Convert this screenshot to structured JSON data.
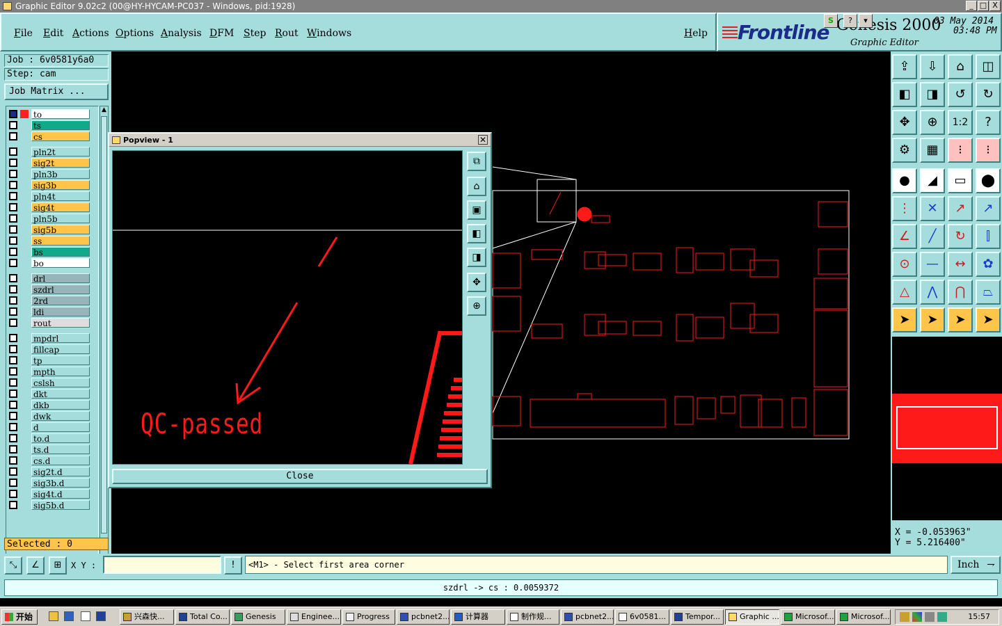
{
  "window": {
    "title": "Graphic Editor 9.02c2 (00@HY-HYCAM-PC037 - Windows, pid:1928)",
    "controls": [
      "_",
      "□",
      "X"
    ]
  },
  "menu": {
    "items": [
      "File",
      "Edit",
      "Actions",
      "Options",
      "Analysis",
      "DFM",
      "Step",
      "Rout",
      "Windows"
    ],
    "help": "Help"
  },
  "brand": {
    "logo": "Frontline",
    "product": "Genesis 2000",
    "subtitle": "Graphic Editor",
    "date": "03 May 2014",
    "time": "03:48 PM"
  },
  "job": {
    "job_label": "Job : 6v0581y6a0",
    "step_label": "Step: cam",
    "matrix_button": "Job Matrix ..."
  },
  "layers": [
    {
      "name": "to",
      "color": "#ffffff",
      "active": true
    },
    {
      "name": "ts",
      "color": "#12a98a"
    },
    {
      "name": "cs",
      "color": "#ffc54a"
    },
    {
      "name": "pln2t",
      "color": "#a5dcdc"
    },
    {
      "name": "sig2t",
      "color": "#ffc54a"
    },
    {
      "name": "pln3b",
      "color": "#a5dcdc"
    },
    {
      "name": "sig3b",
      "color": "#ffc54a"
    },
    {
      "name": "pln4t",
      "color": "#a5dcdc"
    },
    {
      "name": "sig4t",
      "color": "#ffc54a"
    },
    {
      "name": "pln5b",
      "color": "#a5dcdc"
    },
    {
      "name": "sig5b",
      "color": "#ffc54a"
    },
    {
      "name": "ss",
      "color": "#ffc54a"
    },
    {
      "name": "bs",
      "color": "#12a98a"
    },
    {
      "name": "bo",
      "color": "#ffffff"
    },
    {
      "name": "drl",
      "color": "#97b4b8"
    },
    {
      "name": "szdrl",
      "color": "#97b4b8"
    },
    {
      "name": "2rd",
      "color": "#97b4b8"
    },
    {
      "name": "ldi",
      "color": "#97b4b8"
    },
    {
      "name": "rout",
      "color": "#dddddd"
    },
    {
      "name": "mpdrl",
      "color": "#a5dcdc"
    },
    {
      "name": "fillcap",
      "color": "#a5dcdc"
    },
    {
      "name": "tp",
      "color": "#a5dcdc"
    },
    {
      "name": "mpth",
      "color": "#a5dcdc"
    },
    {
      "name": "cslsh",
      "color": "#a5dcdc"
    },
    {
      "name": "dkt",
      "color": "#a5dcdc"
    },
    {
      "name": "dkb",
      "color": "#a5dcdc"
    },
    {
      "name": "dwk",
      "color": "#a5dcdc"
    },
    {
      "name": "d",
      "color": "#a5dcdc"
    },
    {
      "name": "to.d",
      "color": "#a5dcdc"
    },
    {
      "name": "ts.d",
      "color": "#a5dcdc"
    },
    {
      "name": "cs.d",
      "color": "#a5dcdc"
    },
    {
      "name": "sig2t.d",
      "color": "#a5dcdc"
    },
    {
      "name": "sig3b.d",
      "color": "#a5dcdc"
    },
    {
      "name": "sig4t.d",
      "color": "#a5dcdc"
    },
    {
      "name": "sig5b.d",
      "color": "#a5dcdc"
    }
  ],
  "selected": "Selected : 0",
  "popview": {
    "title": "Popview - 1",
    "annotation": "QC-passed",
    "close_label": "Close",
    "tools": [
      "zoom-window-icon",
      "home-icon",
      "zoom-in-icon",
      "pan-left-icon",
      "pan-right-icon",
      "fit-icon",
      "fit-all-icon"
    ]
  },
  "toolbox": {
    "rows": [
      [
        "upload-icon",
        "download-icon",
        "home-icon",
        "window-icon"
      ],
      [
        "pan-left-icon",
        "pan-right-icon",
        "undo-icon",
        "redo-icon"
      ],
      [
        "fit-icon",
        "fit-all-icon",
        "ratio-icon",
        "help-icon"
      ],
      [
        "measure-icon",
        "grid-icon",
        "snap-icon",
        "snap-active-icon"
      ],
      [
        "pad-icon",
        "line-icon",
        "ruler-icon",
        "circle-icon"
      ],
      [
        "connect-icon",
        "cross-icon",
        "move-icon",
        "stretch-icon"
      ],
      [
        "angle-icon",
        "diagonal-icon",
        "arc-icon",
        "align-icon"
      ],
      [
        "point-icon",
        "horizontal-icon",
        "dimension-icon",
        "group-icon"
      ],
      [
        "triangle-icon",
        "arch-icon",
        "bridge-icon",
        "trapezoid-icon"
      ],
      [
        "select-icon",
        "select-box-icon",
        "select-touch-icon",
        "select-net-icon"
      ]
    ],
    "ratio_label": "1:2"
  },
  "coords": {
    "x": "X = -0.053963\"",
    "y": "Y = 5.216400\""
  },
  "command": {
    "xy_label": "X Y :",
    "xy_value": "",
    "info_icon": "!",
    "prompt": "<M1> - Select first area corner",
    "units": "Inch"
  },
  "status": "szdrl -> cs : 0.0059372",
  "taskbar": {
    "start": "开始",
    "buttons": [
      "兴森快...",
      "Total Co...",
      "Genesis",
      "Enginee...",
      "Progress",
      "pcbnet2...",
      "计算器",
      "制作规...",
      "pcbnet2...",
      "6v0581...",
      "Tempor...",
      "Graphic ...",
      "Microsof...",
      "Microsof..."
    ],
    "active_index": 11,
    "clock": "15:57"
  },
  "colors": {
    "panel": "#a5dcdc",
    "trace_red": "#ff1a1a",
    "accent_orange": "#ffc54a",
    "accent_teal": "#12a98a"
  }
}
